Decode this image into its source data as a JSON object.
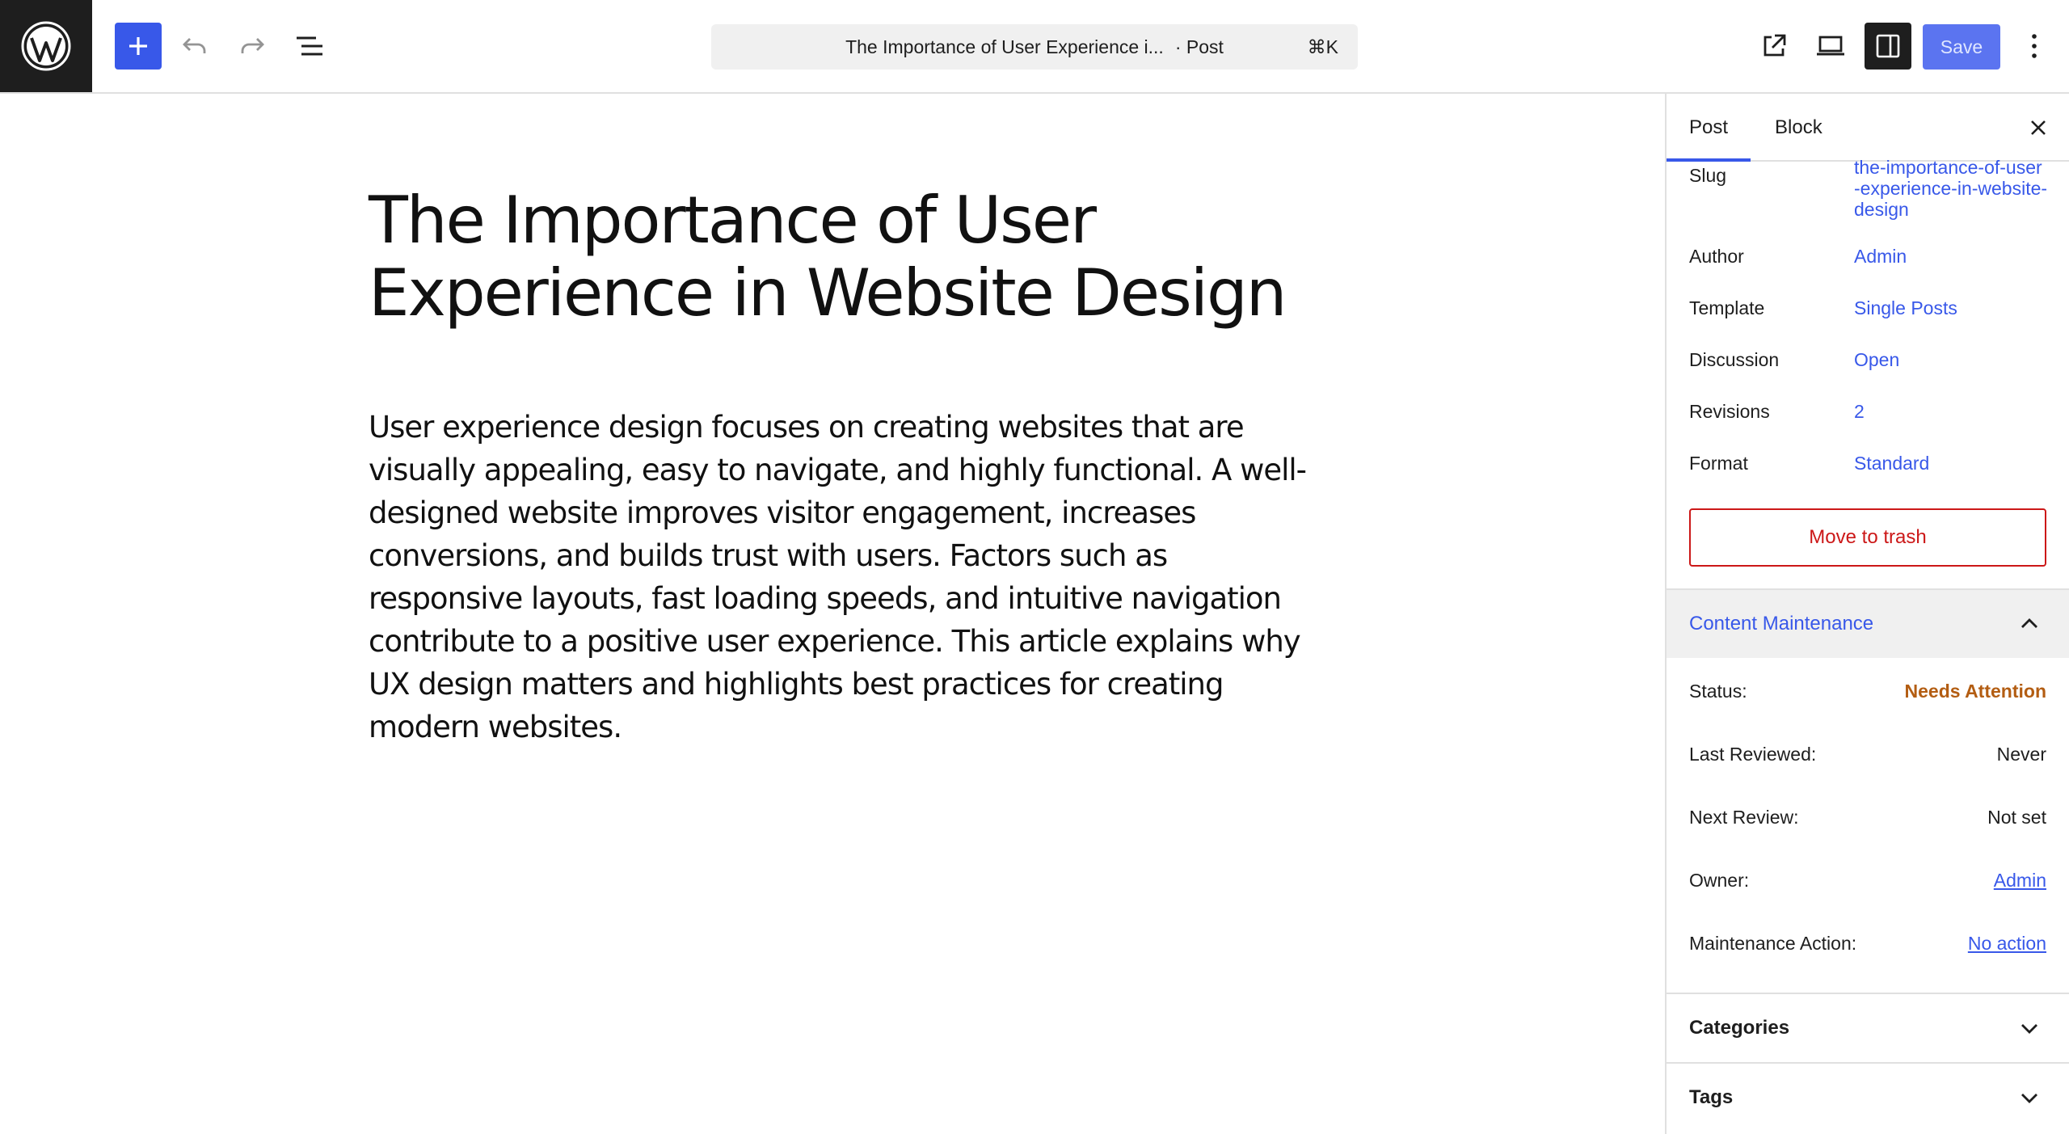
{
  "toolbar": {
    "command_title": "The Importance of User Experience i...",
    "command_type": "· Post",
    "command_shortcut": "⌘K",
    "save_label": "Save"
  },
  "post": {
    "title": "The Importance of User Experience in Website Design",
    "body": "User experience design focuses on creating websites that are visually appealing, easy to navigate, and highly functional. A well-designed website improves visitor engagement, increases conversions, and builds trust with users. Factors such as responsive layouts, fast loading speeds, and intuitive navigation contribute to a positive user experience. This article explains why UX design matters and highlights best practices for creating modern websites."
  },
  "sidebar": {
    "tabs": [
      {
        "label": "Post"
      },
      {
        "label": "Block"
      }
    ],
    "meta": {
      "slug_label": "Slug",
      "slug_value": "the-importance-of-user-experience-in-website-design",
      "author_label": "Author",
      "author_value": "Admin",
      "template_label": "Template",
      "template_value": "Single Posts",
      "discussion_label": "Discussion",
      "discussion_value": "Open",
      "revisions_label": "Revisions",
      "revisions_value": "2",
      "format_label": "Format",
      "format_value": "Standard"
    },
    "trash_label": "Move to trash",
    "content_maintenance": {
      "title": "Content Maintenance",
      "status_label": "Status:",
      "status_value": "Needs Attention",
      "last_reviewed_label": "Last Reviewed:",
      "last_reviewed_value": "Never",
      "next_review_label": "Next Review:",
      "next_review_value": "Not set",
      "owner_label": "Owner:",
      "owner_value": "Admin",
      "action_label": "Maintenance Action:",
      "action_value": "No action"
    },
    "panels": {
      "categories": "Categories",
      "tags": "Tags"
    }
  },
  "colors": {
    "accent": "#3858e9",
    "danger": "#cc1818",
    "attention": "#b35d12"
  }
}
